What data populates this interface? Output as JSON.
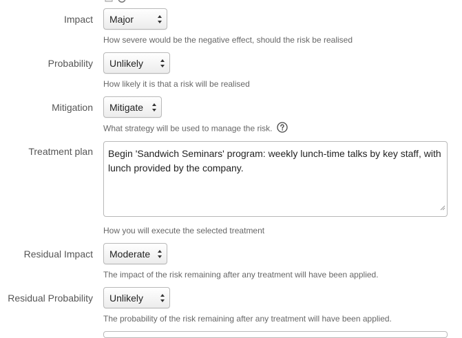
{
  "fields": {
    "impact": {
      "label": "Impact",
      "value": "Major",
      "help": "How severe would be the negative effect, should the risk be realised"
    },
    "probability": {
      "label": "Probability",
      "value": "Unlikely",
      "help": "How likely it is that a risk will be realised"
    },
    "mitigation": {
      "label": "Mitigation",
      "value": "Mitigate",
      "help": "What strategy will be used to manage the risk.",
      "help_icon": "question-circle-icon"
    },
    "treatment_plan": {
      "label": "Treatment plan",
      "value": "Begin 'Sandwich Seminars' program: weekly lunch-time talks by key staff, with lunch provided by the company.",
      "help": "How you will execute the selected treatment"
    },
    "residual_impact": {
      "label": "Residual Impact",
      "value": "Moderate",
      "help": "The impact of the risk remaining after any treatment will have been applied."
    },
    "residual_probability": {
      "label": "Residual Probability",
      "value": "Unlikely",
      "help": "The probability of the risk remaining after any treatment will have been applied."
    }
  }
}
